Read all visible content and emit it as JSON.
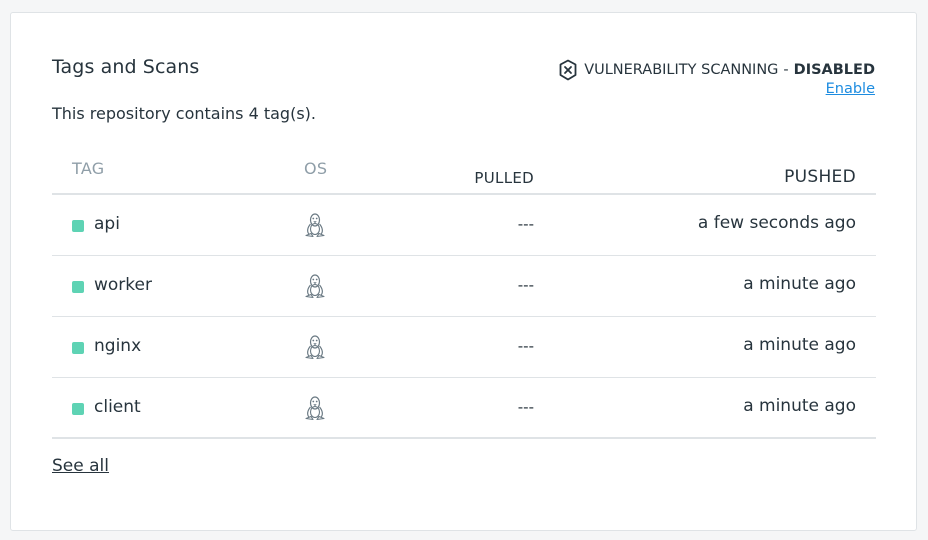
{
  "panel": {
    "title": "Tags and Scans",
    "scan_label": "VULNERABILITY SCANNING",
    "scan_separator": "-",
    "scan_state": "DISABLED",
    "enable_link": "Enable",
    "description": "This repository contains 4 tag(s).",
    "see_all": "See all"
  },
  "table": {
    "headers": {
      "tag": "TAG",
      "os": "OS",
      "pulled": "PULLED",
      "pushed": "PUSHED"
    },
    "rows": [
      {
        "tag": "api",
        "os_icon": "linux-icon",
        "pulled": "---",
        "pushed": "a few seconds ago"
      },
      {
        "tag": "worker",
        "os_icon": "linux-icon",
        "pulled": "---",
        "pushed": "a minute ago"
      },
      {
        "tag": "nginx",
        "os_icon": "linux-icon",
        "pulled": "---",
        "pushed": "a minute ago"
      },
      {
        "tag": "client",
        "os_icon": "linux-icon",
        "pulled": "---",
        "pushed": "a minute ago"
      }
    ]
  },
  "colors": {
    "status_dot": "#5ed3b4",
    "link": "#1d8ce0",
    "header_text": "#8f9ea8"
  }
}
